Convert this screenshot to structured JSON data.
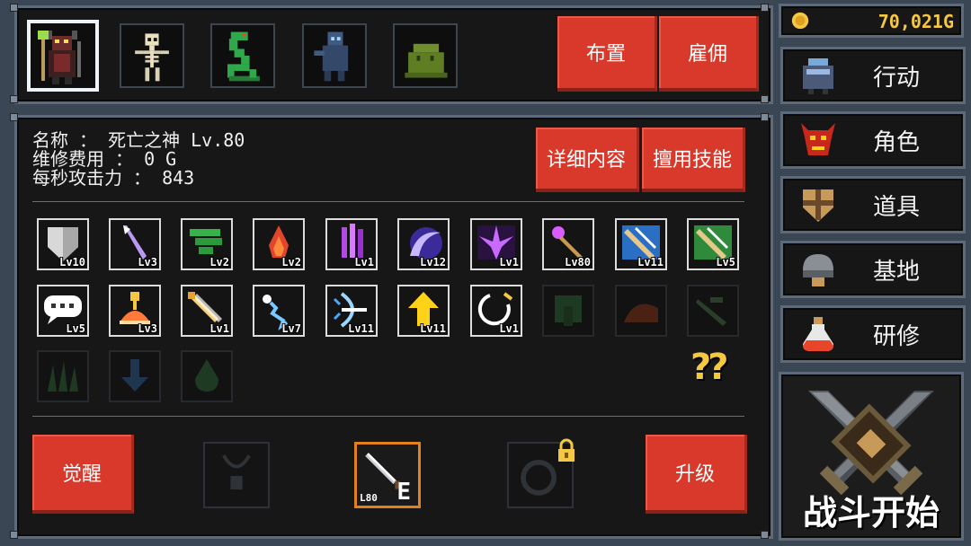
{
  "gold": {
    "amount": "70,021G"
  },
  "top_buttons": {
    "deploy": "布置",
    "hire": "雇佣"
  },
  "character": {
    "name_line": "名称 ： 死亡之神 Lv.80",
    "upkeep_line": "维修费用 ： 0 G",
    "attack_line": "每秒攻击力 ： 843"
  },
  "detail_buttons": {
    "details": "详细内容",
    "use_skill": "擅用技能"
  },
  "skills": [
    {
      "level": "Lv10"
    },
    {
      "level": "Lv3"
    },
    {
      "level": "Lv2"
    },
    {
      "level": "Lv2"
    },
    {
      "level": "Lv1"
    },
    {
      "level": "Lv12"
    },
    {
      "level": "Lv1"
    },
    {
      "level": "Lv80"
    },
    {
      "level": "Lv11"
    },
    {
      "level": "Lv5"
    },
    {
      "level": "Lv5"
    },
    {
      "level": "Lv3"
    },
    {
      "level": "Lv1"
    },
    {
      "level": "Lv7"
    },
    {
      "level": "Lv11"
    },
    {
      "level": "Lv11"
    },
    {
      "level": "Lv1"
    }
  ],
  "help_text": "??",
  "bottom": {
    "awaken": "觉醒",
    "upgrade": "升级",
    "weapon_level": "L80",
    "weapon_rank": "E"
  },
  "sidebar": {
    "items": [
      {
        "label": "行动"
      },
      {
        "label": "角色"
      },
      {
        "label": "道具"
      },
      {
        "label": "基地"
      },
      {
        "label": "研修"
      }
    ],
    "battle": "战斗开始"
  },
  "colors": {
    "accent_red": "#d8392a",
    "gold_text": "#f5c842",
    "frame": "#5c6a7a"
  }
}
